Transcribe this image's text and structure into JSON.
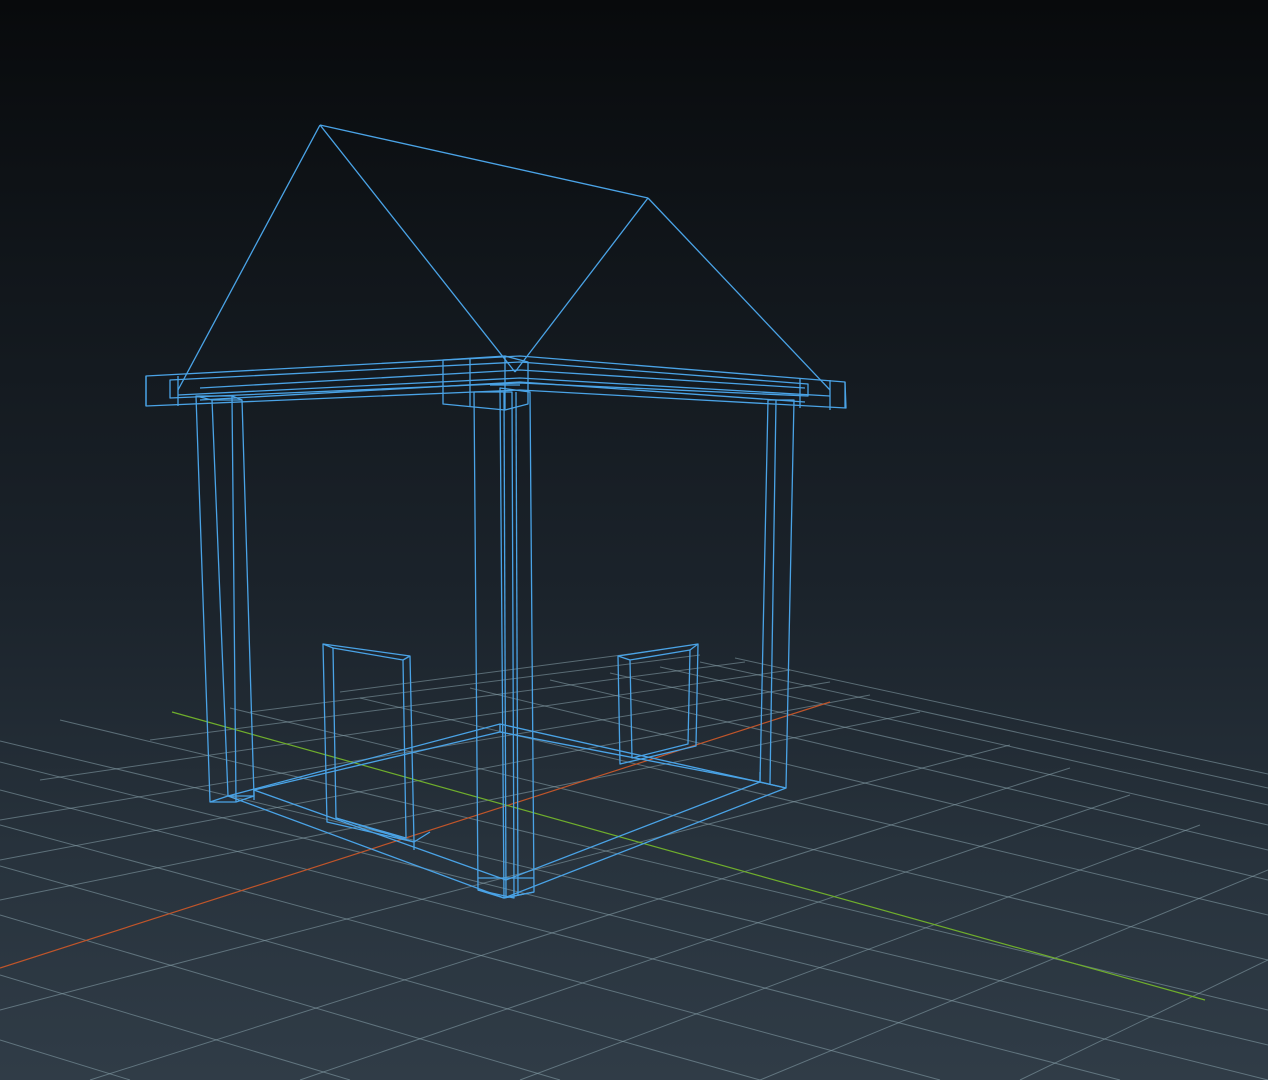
{
  "viewport": {
    "mode": "wireframe",
    "object": "gazebo"
  },
  "colors": {
    "background_top": "#080a0c",
    "background_bottom": "#303c47",
    "grid": "#8aa4ad",
    "wireframe": "#4aa3e6",
    "axis_x": "#c0552a",
    "axis_z": "#6fae2c"
  }
}
